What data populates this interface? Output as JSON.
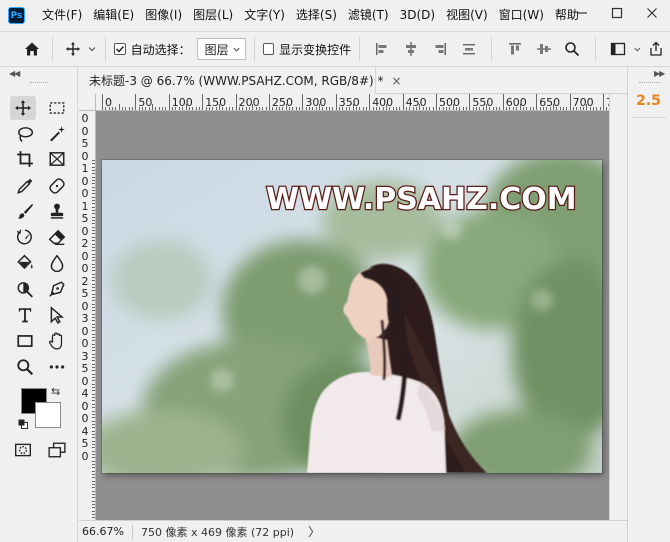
{
  "app": {
    "logo_text": "Ps",
    "menu": [
      "文件(F)",
      "编辑(E)",
      "图像(I)",
      "图层(L)",
      "文字(Y)",
      "选择(S)",
      "滤镜(T)",
      "3D(D)",
      "视图(V)",
      "窗口(W)",
      "帮助"
    ]
  },
  "options_bar": {
    "auto_select_label": "自动选择：",
    "auto_select_checked": true,
    "layer_select_value": "图层",
    "show_transform_label": "显示变换控件",
    "show_transform_checked": false
  },
  "document": {
    "tab_title": "未标题-3 @ 66.7% (WWW.PSAHZ.COM, RGB/8#) *",
    "close_glyph": "×",
    "watermark_text": "WWW.PSAHZ.COM",
    "ruler_top_labels": [
      "0",
      "50",
      "100",
      "150",
      "200",
      "250",
      "300",
      "350",
      "400",
      "450",
      "500",
      "550",
      "600",
      "650",
      "700",
      "7"
    ],
    "ruler_left_labels": [
      "0",
      "0",
      "5",
      "0",
      "1",
      "0",
      "0",
      "1",
      "5",
      "0",
      "2",
      "0",
      "0",
      "2",
      "5",
      "0",
      "3",
      "0",
      "0",
      "3",
      "5",
      "0",
      "4",
      "0",
      "0",
      "4",
      "5",
      "0"
    ]
  },
  "status_bar": {
    "zoom": "66.67%",
    "info": "750 像素 x 469 像素 (72 ppi)",
    "arrow": "〉"
  },
  "right_panel": {
    "version_label": "2.5"
  },
  "colors": {
    "foreground": "#000000",
    "background": "#ffffff",
    "accent_orange": "#e8821a",
    "watermark_outline": "#5a1a16"
  }
}
